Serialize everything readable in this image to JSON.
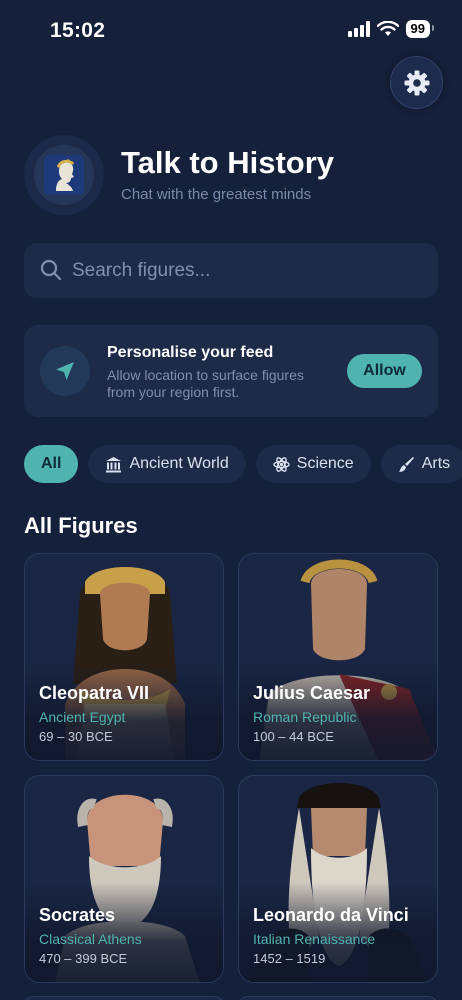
{
  "status_bar": {
    "time": "15:02",
    "battery": "99"
  },
  "header": {
    "title": "Talk to History",
    "subtitle": "Chat with the greatest minds"
  },
  "search": {
    "placeholder": "Search figures..."
  },
  "location_prompt": {
    "title": "Personalise your feed",
    "description": "Allow location to surface figures from your region first.",
    "button_label": "Allow"
  },
  "filters": [
    {
      "label": "All",
      "icon": "",
      "active": true
    },
    {
      "label": "Ancient World",
      "icon": "columns-icon",
      "active": false
    },
    {
      "label": "Science",
      "icon": "atom-icon",
      "active": false
    },
    {
      "label": "Arts",
      "icon": "brush-icon",
      "active": false
    }
  ],
  "section_title": "All Figures",
  "figures": [
    {
      "name": "Cleopatra VII",
      "era": "Ancient Egypt",
      "years": "69 – 30 BCE"
    },
    {
      "name": "Julius Caesar",
      "era": "Roman Republic",
      "years": "100 – 44 BCE"
    },
    {
      "name": "Socrates",
      "era": "Classical Athens",
      "years": "470 – 399 BCE"
    },
    {
      "name": "Leonardo da Vinci",
      "era": "Italian Renaissance",
      "years": "1452 – 1519"
    }
  ],
  "colors": {
    "background": "#15203a",
    "surface": "#1d2a48",
    "accent": "#4fb3b0",
    "muted_text": "#7f8fae"
  }
}
